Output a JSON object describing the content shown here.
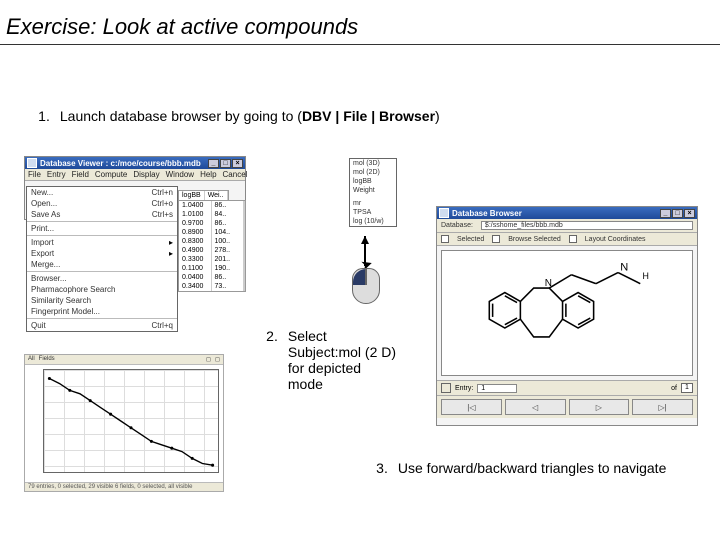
{
  "title": "Exercise: Look at active compounds",
  "steps": {
    "s1": {
      "num": "1.",
      "text_pre": "Launch database browser by going to (",
      "bold": "DBV | File | Browser",
      "text_post": ")"
    },
    "s2": {
      "num": "2.",
      "l1": "Select",
      "l2": "Subject:mol (2 D)",
      "l3": "for depicted",
      "l4": "mode"
    },
    "s3": {
      "num": "3.",
      "text": "Use forward/backward triangles to navigate"
    }
  },
  "dv_window": {
    "title": "Database Viewer : c:/moe/course/bbb.mdb",
    "menubar": [
      "File",
      "Entry",
      "Field",
      "Compute",
      "Display",
      "Window",
      "Help"
    ],
    "cancel": "Cancel",
    "cols": [
      "logBB",
      "Wei.."
    ]
  },
  "file_menu": {
    "items": [
      {
        "label": "New...",
        "accel": "Ctrl+n"
      },
      {
        "label": "Open...",
        "accel": "Ctrl+o"
      },
      {
        "label": "Save As",
        "accel": "Ctrl+s"
      },
      {
        "sep": true
      },
      {
        "label": "Print...",
        "accel": ""
      },
      {
        "sep": true
      },
      {
        "label": "Import",
        "accel": "",
        "sub": true
      },
      {
        "label": "Export",
        "accel": "",
        "sub": true
      },
      {
        "label": "Merge...",
        "accel": ""
      },
      {
        "sep": true
      },
      {
        "label": "Browser...",
        "accel": ""
      },
      {
        "label": "Pharmacophore Search",
        "accel": ""
      },
      {
        "label": "Similarity Search",
        "accel": ""
      },
      {
        "label": "Fingerprint Model...",
        "accel": ""
      },
      {
        "sep": true
      },
      {
        "label": "Quit",
        "accel": "Ctrl+q"
      }
    ]
  },
  "subject_dropdown": {
    "items": [
      "mol (3D)",
      "mol (2D)",
      "logBB",
      "Weight",
      "mr",
      "TPSA",
      "log (10/w)"
    ]
  },
  "chart": {
    "toprow": [
      "All",
      "Fields",
      "",
      "◻",
      "◻"
    ],
    "status": "79 entries, 0 selected, 29 visible  6 fields, 0 selected, all visible"
  },
  "db_browser": {
    "title": "Database Browser",
    "db_label": "Database:",
    "db_value": "$:/sshome_files/bbb.mdb",
    "selected": "Selected",
    "browse_sel": "Browse Selected",
    "layout": "Layout Coordinates",
    "entry_label": "Entry:",
    "entry_value": "1",
    "of": "of",
    "total": "1",
    "nav": [
      "|◁",
      "◁",
      "▷",
      "▷|"
    ]
  }
}
